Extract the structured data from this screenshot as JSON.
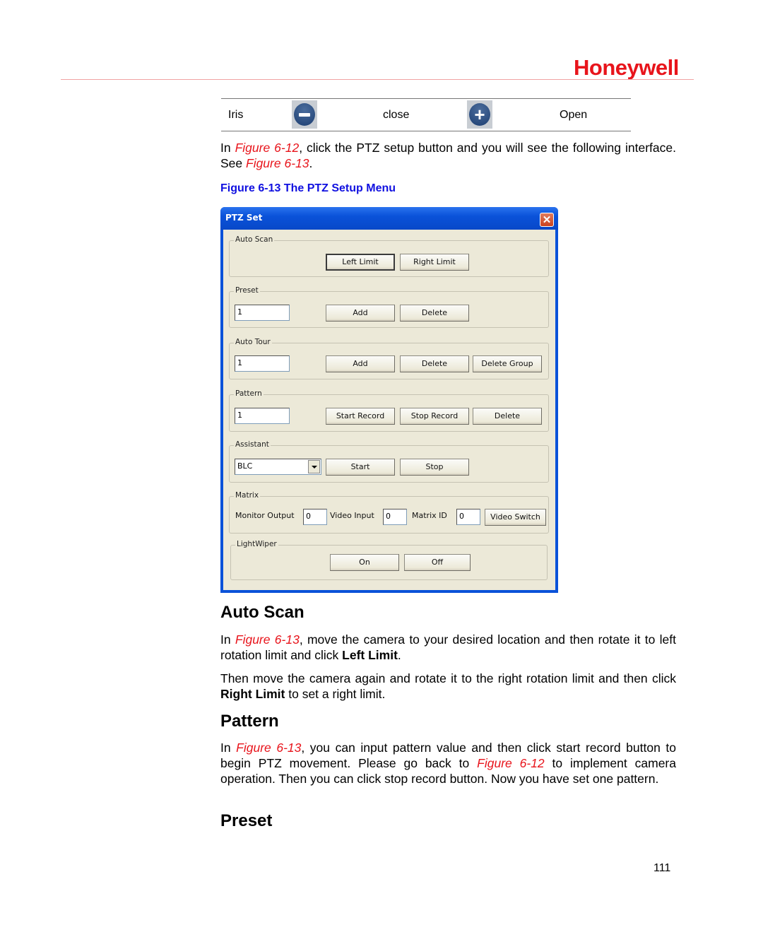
{
  "header": {
    "brand": "Honeywell",
    "brand_color": "#e8141b"
  },
  "iris_table": {
    "label": "Iris",
    "close_icon": "minus-circle-icon",
    "close_label": "close",
    "open_icon": "plus-circle-icon",
    "open_label": "Open"
  },
  "intro": {
    "p1_a": "In ",
    "p1_fig1": "Figure 6-12",
    "p1_b": ", click the PTZ setup button and you will see the following interface. See ",
    "p1_fig2": "Figure 6-13",
    "p1_c": "."
  },
  "caption": "Figure 6-13 The PTZ Setup Menu",
  "dialog": {
    "title": "PTZ Set",
    "close_glyph": "✕",
    "auto_scan": {
      "legend": "Auto Scan",
      "left_limit": "Left Limit",
      "right_limit": "Right Limit"
    },
    "preset": {
      "legend": "Preset",
      "value": "1",
      "add": "Add",
      "delete": "Delete"
    },
    "auto_tour": {
      "legend": "Auto Tour",
      "value": "1",
      "add": "Add",
      "delete": "Delete",
      "delete_group": "Delete Group"
    },
    "pattern": {
      "legend": "Pattern",
      "value": "1",
      "start_record": "Start Record",
      "stop_record": "Stop Record",
      "delete": "Delete"
    },
    "assistant": {
      "legend": "Assistant",
      "selected": "BLC",
      "start": "Start",
      "stop": "Stop"
    },
    "matrix": {
      "legend": "Matrix",
      "monitor_output_label": "Monitor Output",
      "monitor_output_value": "0",
      "video_input_label": "Video Input",
      "video_input_value": "0",
      "matrix_id_label": "Matrix ID",
      "matrix_id_value": "0",
      "video_switch": "Video Switch"
    },
    "light_wiper": {
      "legend": "LightWiper",
      "on": "On",
      "off": "Off"
    }
  },
  "auto_scan_section": {
    "heading": "Auto Scan",
    "p1_a": "In ",
    "p1_fig": "Figure 6-13",
    "p1_b": ", move the camera to your desired location and then rotate it to left rotation limit and click ",
    "p1_bold": "Left Limit",
    "p1_c": ".",
    "p2_a": "Then move the camera again and rotate it to the right rotation limit and then click ",
    "p2_bold": "Right Limit",
    "p2_b": " to set a right limit."
  },
  "pattern_section": {
    "heading": "Pattern",
    "p_a": "In ",
    "p_fig1": "Figure 6-13",
    "p_b": ", you can input pattern value and then click start record button to begin PTZ movement. Please go back to ",
    "p_fig2": "Figure 6-12",
    "p_c": " to implement camera operation. Then you can click stop record button. Now you have set one pattern."
  },
  "preset_section": {
    "heading": "Preset"
  },
  "footer": {
    "page_number": "111"
  }
}
